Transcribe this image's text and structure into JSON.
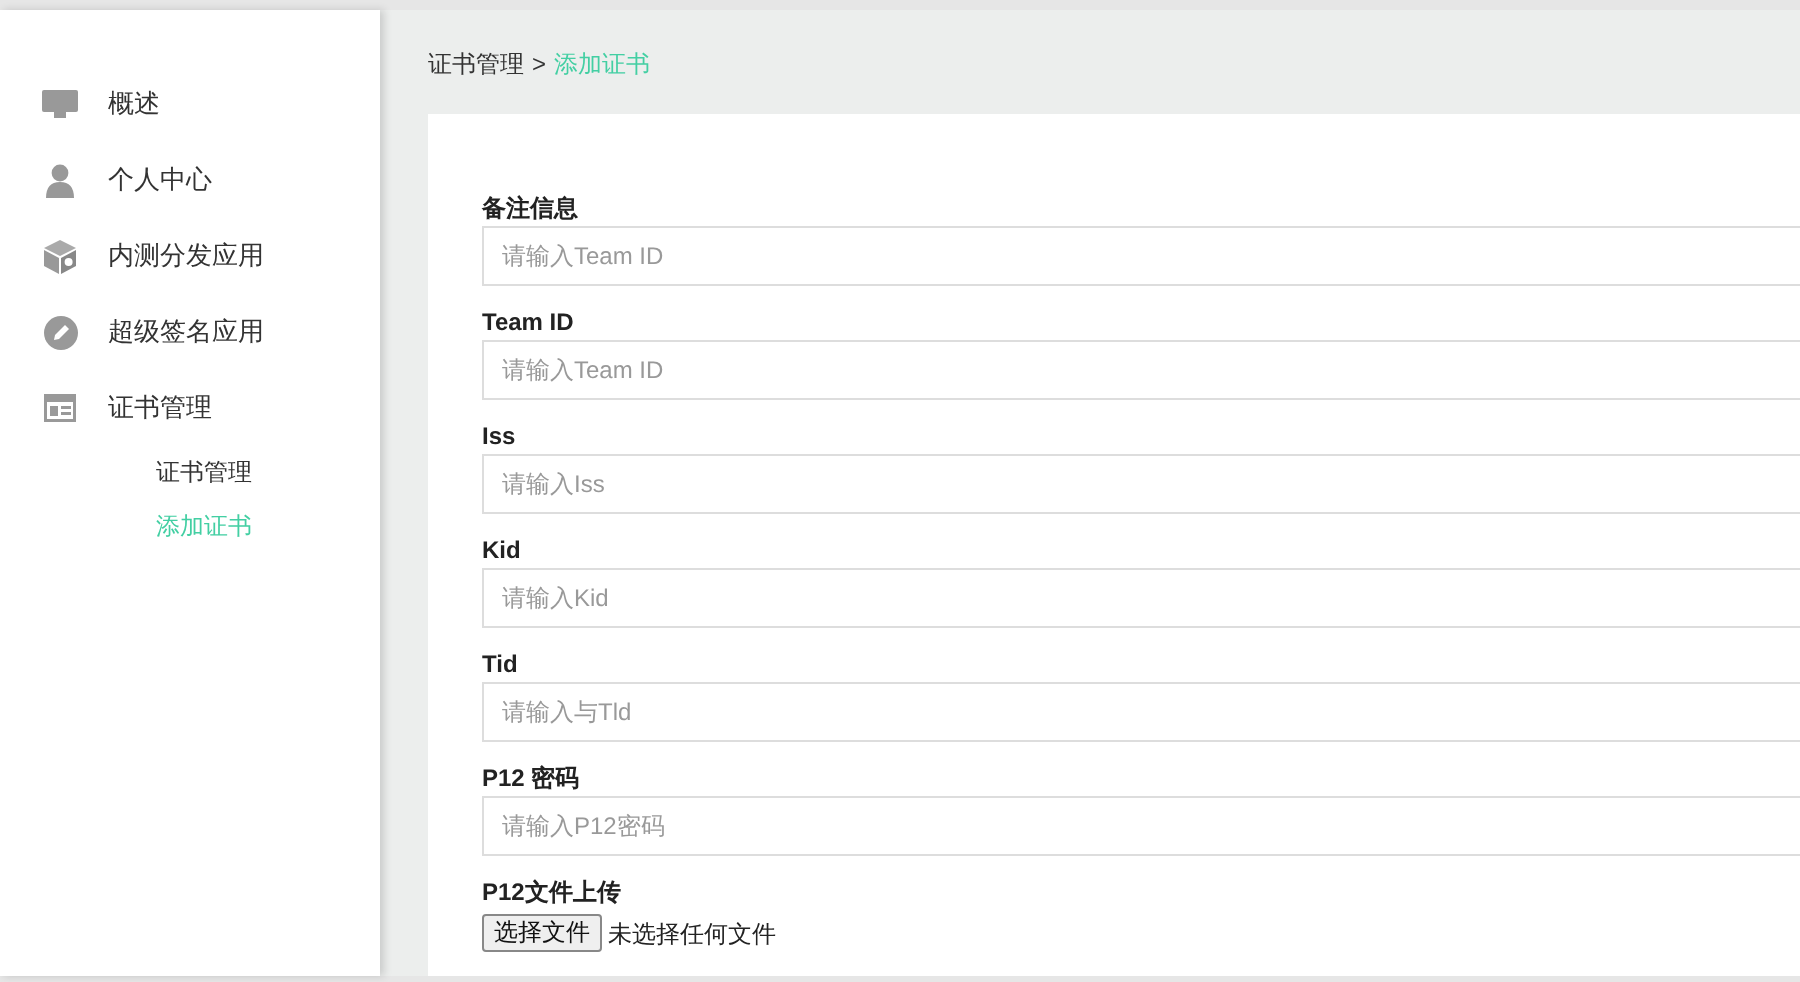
{
  "sidebar": {
    "items": [
      {
        "label": "概述"
      },
      {
        "label": "个人中心"
      },
      {
        "label": "内测分发应用"
      },
      {
        "label": "超级签名应用"
      },
      {
        "label": "证书管理",
        "children": [
          {
            "label": "证书管理",
            "selected": false
          },
          {
            "label": "添加证书",
            "selected": true
          }
        ]
      }
    ]
  },
  "breadcrumb": {
    "parent": "证书管理",
    "separator": ">",
    "current": "添加证书"
  },
  "form": {
    "fields": [
      {
        "kind": "text",
        "label": "备注信息",
        "placeholder": "请输入Team ID"
      },
      {
        "kind": "text",
        "label": "Team ID",
        "placeholder": "请输入Team ID"
      },
      {
        "kind": "text",
        "label": "Iss",
        "placeholder": "请输入Iss"
      },
      {
        "kind": "text",
        "label": "Kid",
        "placeholder": "请输入Kid"
      },
      {
        "kind": "text",
        "label": "Tid",
        "placeholder": "请输入与Tld"
      },
      {
        "kind": "text",
        "label": "P12 密码",
        "placeholder": "请输入P12密码"
      },
      {
        "kind": "file",
        "label": "P12文件上传",
        "button": "选择文件",
        "status": "未选择任何文件"
      }
    ]
  }
}
